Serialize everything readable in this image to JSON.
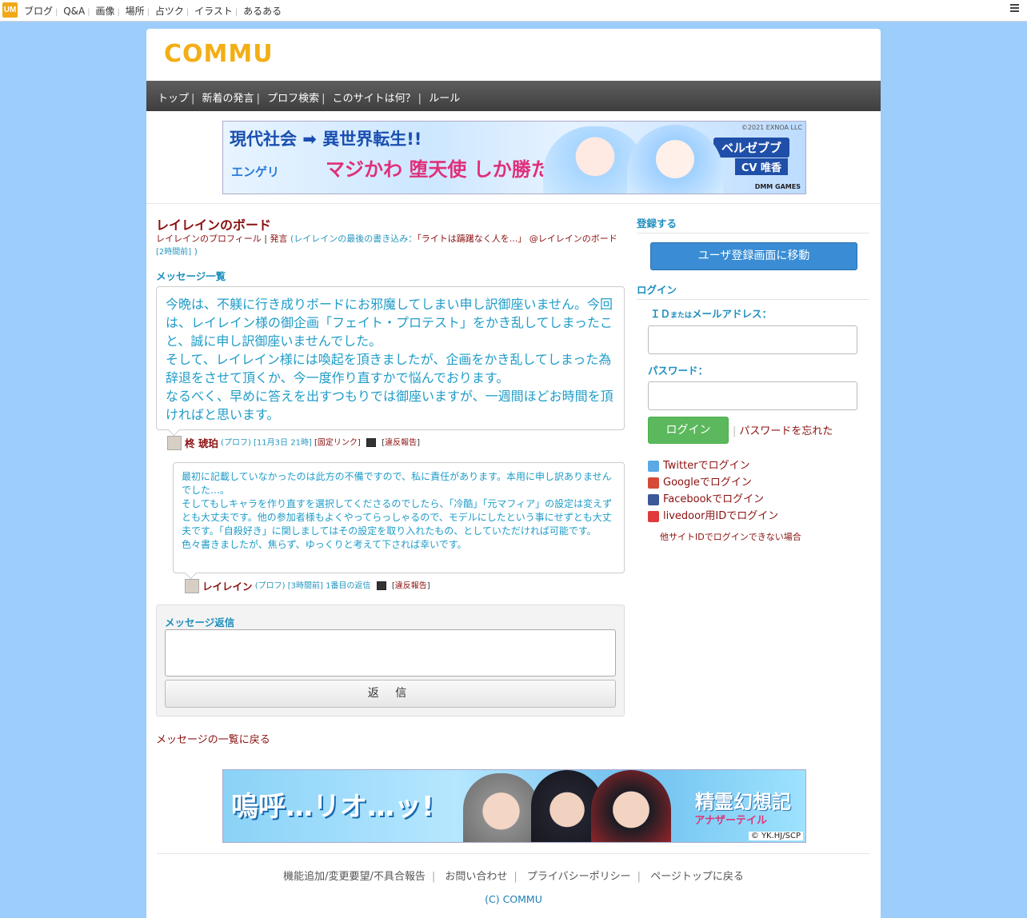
{
  "topbar": {
    "logo": "UM",
    "links": [
      "ブログ",
      "Q&A",
      "画像",
      "場所",
      "占ツク",
      "イラスト",
      "あるある"
    ]
  },
  "header": {
    "logo": "COMMU"
  },
  "nav": {
    "items": [
      "トップ",
      "新着の発言",
      "プロフ検索",
      "このサイトは何？",
      "ルール"
    ]
  },
  "banner_top": {
    "line1": "現代社会 ➡ 異世界転生!!",
    "line2": "マジかわ 堕天使 しか勝たん!",
    "logo": "エンゲリ",
    "chip": "ベルゼブブ",
    "cv": "CV 唯香",
    "copyright": "©2021 EXNOA LLC",
    "brand": "DMM GAMES"
  },
  "board": {
    "title": "レイレインのボード",
    "profile_link": "レイレインのプロフィール",
    "sep": "|",
    "posts_link": "発言",
    "last_post_open": " (レイレインの最後の書き込み：",
    "last_post_quote": "「ライトは躊躇なく人を...」",
    "last_post_board": " @レイレインのボード",
    "last_post_time": " [2時間前]",
    "last_post_close": " )"
  },
  "message_list_heading": "メッセージ一覧",
  "message1": {
    "text": "今晩は、不躾に行き成りボードにお邪魔してしまい申し訳御座いません。今回は、レイレイン様の御企画「フェイト・プロテスト」をかき乱してしまったこと、誠に申し訳御座いませんでした。\nそして、レイレイン様には喚起を頂きましたが、企画をかき乱してしまった為辞退をさせて頂くか、今一度作り直すかで悩んでおります。\nなるべく、早めに答えを出すつもりでは御座いますが、一週間ほどお時間を頂ければと思います。",
    "author": "柊 琥珀",
    "prof": "(プロフ)",
    "time": "[11月3日 21時]",
    "permalink": "[固定リンク]",
    "report": "違反報告"
  },
  "message2": {
    "text": "最初に記載していなかったのは此方の不備ですので、私に責任があります。本用に申し訳ありませんでした…。\nそしてもしキャラを作り直すを選択してくださるのでしたら、「冷酷」「元マフィア」の設定は変えずとも大丈夫です。他の参加者様もよくやってらっしゃるので、モデルにしたという事にせずとも大丈夫です。「自殺好き」に関しましてはその設定を取り入れたもの、としていただければ可能です。\n色々書きましたが、焦らず、ゆっくりと考えて下されば幸いです。",
    "author": "レイレイン",
    "prof": "(プロフ)",
    "time": "[3時間前]",
    "reply_no": "1番目の返信",
    "report": "違反報告"
  },
  "reply": {
    "heading": "メッセージ返信",
    "button": "返 信"
  },
  "back_link": "メッセージの一覧に戻る",
  "sidebar": {
    "register_heading": "登録する",
    "register_button": "ユーザ登録画面に移動",
    "login_heading": "ログイン",
    "id_label_a": "ＩＤ",
    "id_label_b": "または",
    "id_label_c": "メールアドレス：",
    "password_label": "パスワード：",
    "login_button": "ログイン",
    "forgot": "パスワードを忘れた",
    "sns": [
      {
        "label": "Twitterでログイン",
        "icon": "twitter-icon",
        "color": "#5aa9e6"
      },
      {
        "label": "Googleでログイン",
        "icon": "google-icon",
        "color": "#d64937"
      },
      {
        "label": "Facebookでログイン",
        "icon": "facebook-icon",
        "color": "#3b5998"
      },
      {
        "label": "livedoor用IDでログイン",
        "icon": "livedoor-icon",
        "color": "#e03a3a"
      }
    ],
    "other_id": "他サイトIDでログインできない場合"
  },
  "banner_bottom": {
    "text": "嗚呼…リオ…ッ!",
    "logo": "精霊幻想記",
    "sub": "アナザーテイル",
    "copyright": "© YK.HJ/SCP"
  },
  "footer": {
    "links": [
      "機能追加/変更要望/不具合報告",
      "お問い合わせ",
      "プライバシーポリシー",
      "ページトップに戻る"
    ],
    "copyright": "(C) COMMU"
  },
  "colors": {
    "background": "#9dcdfb",
    "brand": "#f3ae16",
    "link_red": "#8b1010",
    "link_blue": "#1f8fbe"
  }
}
